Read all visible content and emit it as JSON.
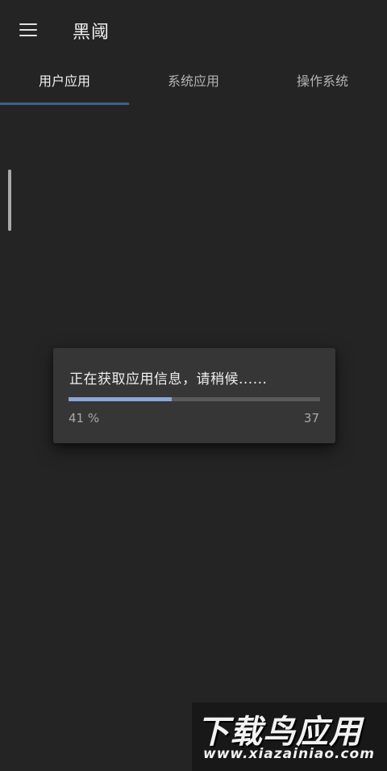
{
  "toolbar": {
    "menu_icon": "hamburger-menu-icon",
    "title": "黑阈"
  },
  "tabs": [
    {
      "label": "用户应用",
      "active": true
    },
    {
      "label": "系统应用",
      "active": false
    },
    {
      "label": "操作系统",
      "active": false
    }
  ],
  "dialog": {
    "message": "正在获取应用信息，请稍候......",
    "progress_percent_text": "41 %",
    "progress_value": 0.41,
    "progress_count": "37"
  },
  "watermark": {
    "title": "下载鸟应用",
    "url": "www.xiazainiao.com"
  },
  "colors": {
    "background": "#242424",
    "dialog": "#363636",
    "accent": "#3d5f8f",
    "progress": "#8aa7d6"
  }
}
